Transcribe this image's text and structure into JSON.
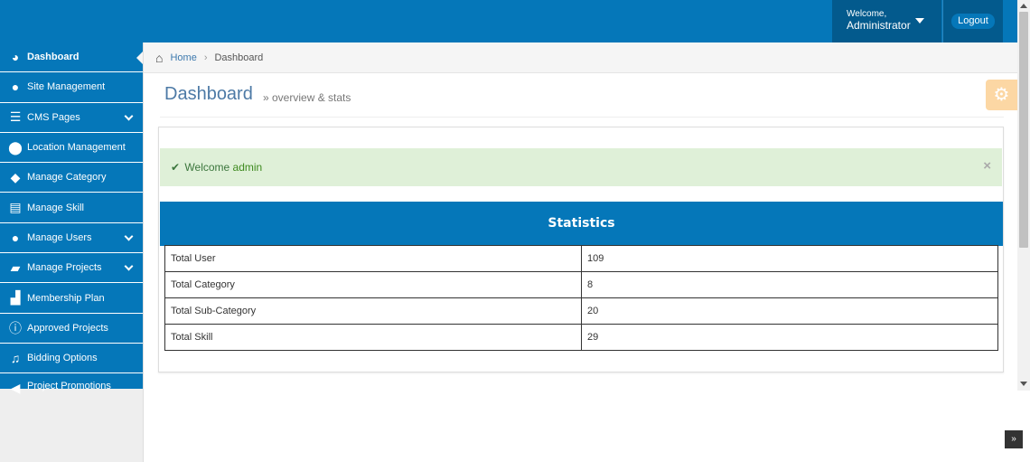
{
  "header": {
    "welcome_text": "Welcome,",
    "user_name": "Administrator",
    "logout_label": "Logout"
  },
  "sidebar": {
    "items": [
      {
        "label": "Dashboard",
        "icon": "dashboard-icon"
      },
      {
        "label": "Site Management",
        "icon": "globe-icon"
      },
      {
        "label": "CMS Pages",
        "icon": "list-icon"
      },
      {
        "label": "Location Management",
        "icon": "map-marker-icon"
      },
      {
        "label": "Manage Category",
        "icon": "tags-icon"
      },
      {
        "label": "Manage Skill",
        "icon": "list-alt-icon"
      },
      {
        "label": "Manage Users",
        "icon": "user-icon"
      },
      {
        "label": "Manage Projects",
        "icon": "book-icon"
      },
      {
        "label": "Membership Plan",
        "icon": "unlock-icon"
      },
      {
        "label": "Approved Projects",
        "icon": "info-icon"
      },
      {
        "label": "Bidding Options",
        "icon": "bell-icon"
      },
      {
        "label": "Project Promotions",
        "icon": "bullhorn-icon"
      }
    ]
  },
  "breadcrumb": {
    "home": "Home",
    "current": "Dashboard"
  },
  "page": {
    "title": "Dashboard",
    "subtitle": "» overview & stats"
  },
  "alert": {
    "text": "Welcome",
    "user": "admin",
    "close": "×"
  },
  "stats": {
    "heading": "Statistics",
    "rows": [
      {
        "label": "Total User",
        "value": "109"
      },
      {
        "label": "Total Category",
        "value": "8"
      },
      {
        "label": "Total Sub-Category",
        "value": "20"
      },
      {
        "label": "Total Skill",
        "value": "29"
      }
    ]
  },
  "colors": {
    "primary": "#0577b9",
    "primary_dark": "#035a8d",
    "alert_bg": "#dff0d8",
    "gear_bg": "#fcd7a4"
  }
}
